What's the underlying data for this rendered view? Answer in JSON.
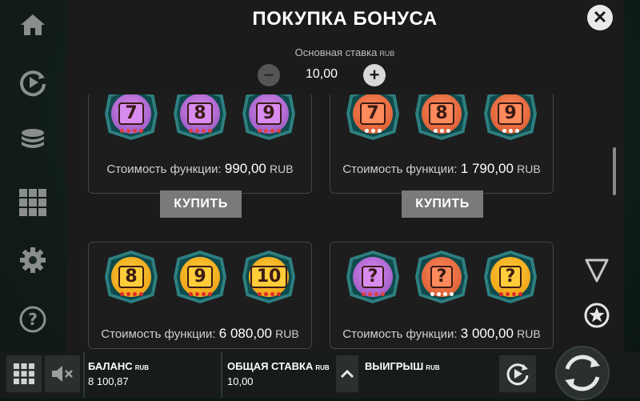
{
  "modal": {
    "title": "ПОКУПКА БОНУСА",
    "close_glyph": "✕",
    "stake_label": "Основная ставка",
    "stake_currency": "RUB",
    "stake_value": "10,00",
    "minus_glyph": "−",
    "plus_glyph": "+"
  },
  "cards": [
    {
      "cost_label": "Стоимость функции:",
      "cost_value": "990,00",
      "currency": "RUB",
      "buy_label": "КУПИТЬ",
      "symbols": [
        {
          "glyph": "7",
          "theme": "purple"
        },
        {
          "glyph": "8",
          "theme": "purple"
        },
        {
          "glyph": "9",
          "theme": "purple"
        }
      ]
    },
    {
      "cost_label": "Стоимость функции:",
      "cost_value": "1 790,00",
      "currency": "RUB",
      "buy_label": "КУПИТЬ",
      "symbols": [
        {
          "glyph": "7",
          "theme": "red"
        },
        {
          "glyph": "8",
          "theme": "red"
        },
        {
          "glyph": "9",
          "theme": "red"
        }
      ]
    },
    {
      "cost_label": "Стоимость функции:",
      "cost_value": "6 080,00",
      "currency": "RUB",
      "buy_label": "",
      "symbols": [
        {
          "glyph": "8",
          "theme": "gold"
        },
        {
          "glyph": "9",
          "theme": "gold"
        },
        {
          "glyph": "10",
          "theme": "gold"
        }
      ]
    },
    {
      "cost_label": "Стоимость функции:",
      "cost_value": "3 000,00",
      "currency": "RUB",
      "buy_label": "",
      "symbols": [
        {
          "glyph": "?",
          "theme": "purple"
        },
        {
          "glyph": "?",
          "theme": "red"
        },
        {
          "glyph": "?",
          "theme": "gold"
        }
      ]
    }
  ],
  "sidebar": {
    "icons": [
      "home-icon",
      "autoplay-icon",
      "coin-stack-icon",
      "grid-icon",
      "gear-icon",
      "help-icon"
    ]
  },
  "right_panel": {
    "icons": [
      "shield-icon",
      "star-icon"
    ]
  },
  "bottom_bar": {
    "balance_label": "БАЛАНС",
    "balance_currency": "RUB",
    "balance_value": "8 100,87",
    "bet_label": "ОБЩАЯ СТАВКА",
    "bet_currency": "RUB",
    "bet_value": "10,00",
    "win_label": "ВЫИГРЫШ",
    "win_currency": "RUB",
    "arrow_glyph": "^"
  },
  "colors": {
    "purple": "#a561c9",
    "red": "#e0643a",
    "gold": "#f0a81c",
    "frame": "#2e7f80",
    "modal_bg": "#1b1b1b",
    "button_grey": "#7a7a7a"
  }
}
